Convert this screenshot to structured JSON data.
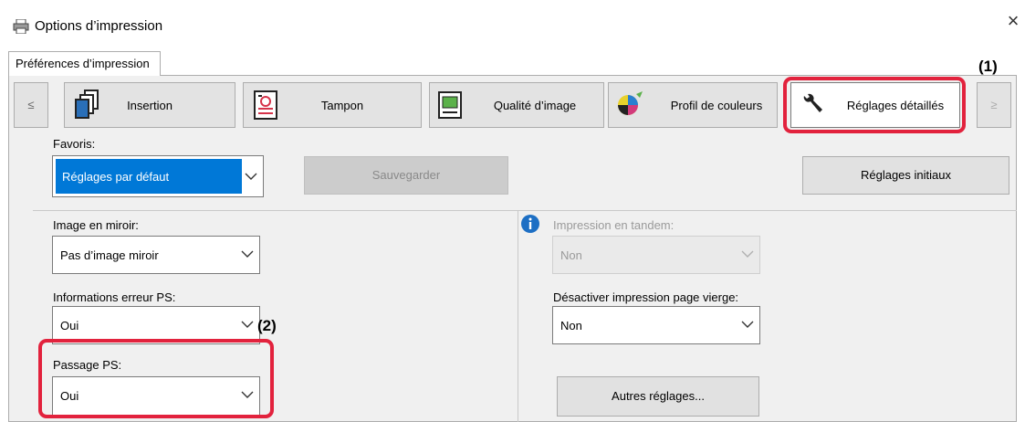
{
  "window": {
    "title": "Options d’impression",
    "close_glyph": "×"
  },
  "tabs": [
    {
      "label": "Préférences d’impression"
    }
  ],
  "strip": {
    "prev_glyph": "≤",
    "next_glyph": "≥",
    "items": [
      {
        "label": "Insertion",
        "icon": "insert-pages-icon"
      },
      {
        "label": "Tampon",
        "icon": "stamp-icon"
      },
      {
        "label": "Qualité d’image",
        "icon": "image-quality-icon"
      },
      {
        "label": "Profil de couleurs",
        "icon": "color-profile-icon"
      },
      {
        "label": "Réglages détaillés",
        "icon": "wrench-icon",
        "active": true
      }
    ]
  },
  "callouts": {
    "one": "(1)",
    "two": "(2)"
  },
  "favorites": {
    "label": "Favoris:",
    "value": "Réglages par défaut",
    "save_label": "Sauvegarder",
    "reset_label": "Réglages initiaux"
  },
  "left": {
    "mirror": {
      "label": "Image en miroir:",
      "value": "Pas d’image miroir"
    },
    "ps_error": {
      "label": "Informations erreur PS:",
      "value": "Oui"
    },
    "ps_pass": {
      "label": "Passage PS:",
      "value": "Oui"
    }
  },
  "right": {
    "tandem": {
      "label": "Impression en tandem:",
      "value": "Non"
    },
    "blank_page": {
      "label": "Désactiver impression page vierge:",
      "value": "Non"
    },
    "other_label": "Autres réglages..."
  },
  "colors": {
    "highlight": "#e2223d",
    "selection": "#0078d7"
  }
}
